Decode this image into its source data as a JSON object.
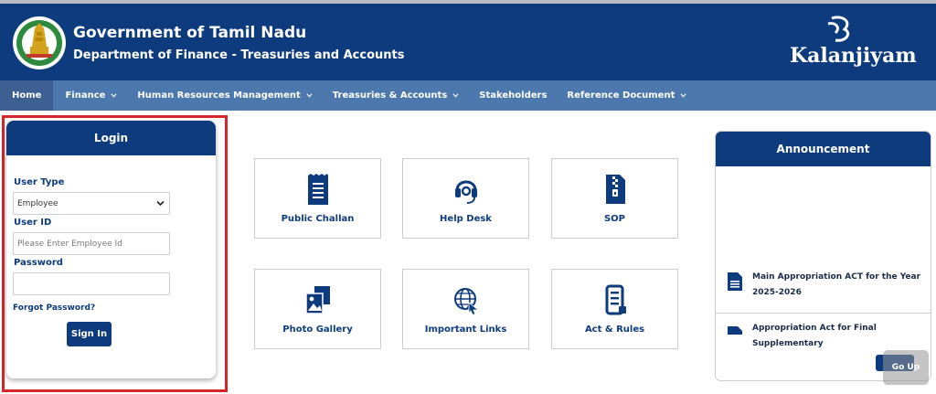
{
  "header": {
    "title": "Government of Tamil Nadu",
    "subtitle": "Department of Finance - Treasuries and Accounts",
    "brand": "Kalanjiyam"
  },
  "nav": {
    "items": [
      {
        "label": "Home",
        "has_dropdown": false
      },
      {
        "label": "Finance",
        "has_dropdown": true
      },
      {
        "label": "Human Resources Management",
        "has_dropdown": true
      },
      {
        "label": "Treasuries & Accounts",
        "has_dropdown": true
      },
      {
        "label": "Stakeholders",
        "has_dropdown": false
      },
      {
        "label": "Reference Document",
        "has_dropdown": true
      }
    ]
  },
  "login": {
    "title": "Login",
    "user_type_label": "User Type",
    "user_type_value": "Employee",
    "user_id_label": "User ID",
    "user_id_placeholder": "Please Enter Employee Id",
    "password_label": "Password",
    "password_value": "",
    "forgot_label": "Forgot Password?",
    "signin_label": "Sign In"
  },
  "tiles": [
    {
      "label": "Public Challan",
      "icon": "receipt-icon"
    },
    {
      "label": "Help Desk",
      "icon": "headset-icon"
    },
    {
      "label": "SOP",
      "icon": "document-zip-icon"
    },
    {
      "label": "Photo Gallery",
      "icon": "photo-gallery-icon"
    },
    {
      "label": "Important Links",
      "icon": "globe-cursor-icon"
    },
    {
      "label": "Act & Rules",
      "icon": "checklist-icon"
    }
  ],
  "announcement": {
    "title": "Announcement",
    "items": [
      {
        "text": "Main Appropriation ACT for the Year 2025-2026"
      },
      {
        "text": "Appropriation Act for Final Supplementary"
      }
    ]
  },
  "goup": {
    "label": "Go Up"
  },
  "colors": {
    "primary": "#0d3b7e",
    "nav": "#4d78ad",
    "highlight": "#d7262b"
  }
}
